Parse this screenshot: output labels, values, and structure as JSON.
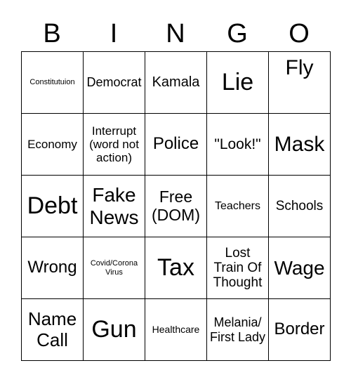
{
  "header": [
    "B",
    "I",
    "N",
    "G",
    "O"
  ],
  "cells": [
    {
      "text": "Constitutuion",
      "size": 11
    },
    {
      "text": "Democrat",
      "size": 18
    },
    {
      "text": "Kamala",
      "size": 20
    },
    {
      "text": "Lie",
      "size": 34
    },
    {
      "text": "Fly",
      "size": 30,
      "top": true
    },
    {
      "text": "Economy",
      "size": 17
    },
    {
      "text": "Interrupt (word not action)",
      "size": 17
    },
    {
      "text": "Police",
      "size": 24
    },
    {
      "text": "\"Look!\"",
      "size": 21
    },
    {
      "text": "Mask",
      "size": 30
    },
    {
      "text": "Debt",
      "size": 34
    },
    {
      "text": "Fake News",
      "size": 28
    },
    {
      "text": "Free (DOM)",
      "size": 23
    },
    {
      "text": "Teachers",
      "size": 16
    },
    {
      "text": "Schools",
      "size": 19
    },
    {
      "text": "Wrong",
      "size": 24
    },
    {
      "text": "Covid/Corona Virus",
      "size": 11
    },
    {
      "text": "Tax",
      "size": 34
    },
    {
      "text": "Lost Train Of Thought",
      "size": 19
    },
    {
      "text": "Wage",
      "size": 28
    },
    {
      "text": "Name Call",
      "size": 26
    },
    {
      "text": "Gun",
      "size": 34
    },
    {
      "text": "Healthcare",
      "size": 14
    },
    {
      "text": "Melania/ First Lady",
      "size": 18
    },
    {
      "text": "Border",
      "size": 24
    }
  ]
}
